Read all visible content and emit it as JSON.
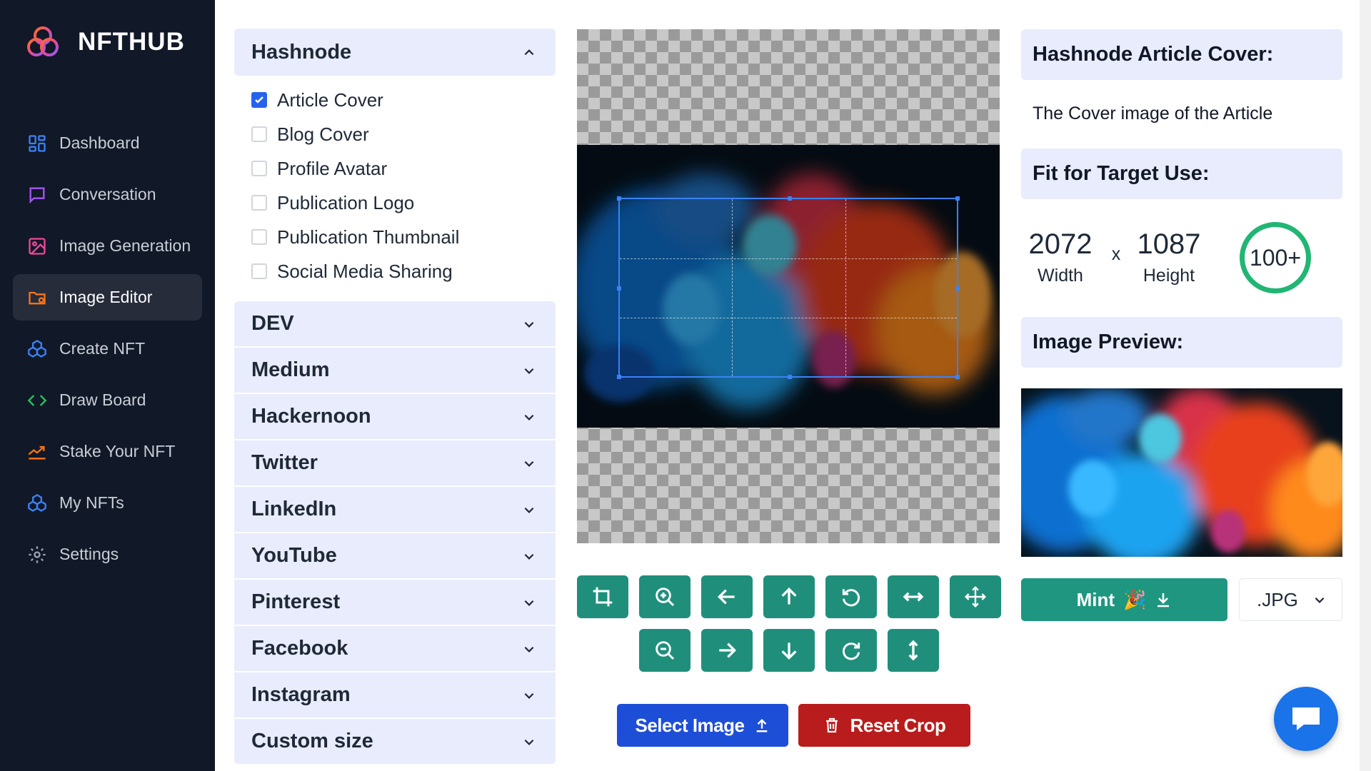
{
  "brand": {
    "name": "NFTHUB"
  },
  "colors": {
    "sidebar_bg": "#111827",
    "accent_teal": "#1f8f7c",
    "select_blue": "#1d4ed8",
    "reset_red": "#b91c1c",
    "score_green": "#22b573"
  },
  "nav": [
    {
      "label": "Dashboard",
      "icon": "dashboard-icon",
      "active": false
    },
    {
      "label": "Conversation",
      "icon": "chat-bubble-icon",
      "active": false
    },
    {
      "label": "Image Generation",
      "icon": "image-icon",
      "active": false
    },
    {
      "label": "Image Editor",
      "icon": "folder-gear-icon",
      "active": true
    },
    {
      "label": "Create NFT",
      "icon": "cubes-icon",
      "active": false
    },
    {
      "label": "Draw Board",
      "icon": "code-icon",
      "active": false
    },
    {
      "label": "Stake Your NFT",
      "icon": "chart-up-icon",
      "active": false
    },
    {
      "label": "My NFTs",
      "icon": "cubes-icon",
      "active": false
    },
    {
      "label": "Settings",
      "icon": "gear-icon",
      "active": false
    }
  ],
  "platforms": {
    "open": {
      "label": "Hashnode",
      "options": [
        {
          "label": "Article Cover",
          "checked": true
        },
        {
          "label": "Blog Cover",
          "checked": false
        },
        {
          "label": "Profile Avatar",
          "checked": false
        },
        {
          "label": "Publication Logo",
          "checked": false
        },
        {
          "label": "Publication Thumbnail",
          "checked": false
        },
        {
          "label": "Social Media Sharing",
          "checked": false
        }
      ]
    },
    "collapsed": [
      "DEV",
      "Medium",
      "Hackernoon",
      "Twitter",
      "LinkedIn",
      "YouTube",
      "Pinterest",
      "Facebook",
      "Instagram",
      "Custom size"
    ]
  },
  "tools": {
    "row1": [
      "crop-icon",
      "zoom-in-icon",
      "arrow-left-icon",
      "arrow-up-icon",
      "rotate-left-icon",
      "flip-horizontal-icon",
      "move-icon"
    ],
    "row2": [
      "zoom-out-icon",
      "arrow-right-icon",
      "arrow-down-icon",
      "rotate-right-icon",
      "flip-vertical-icon"
    ]
  },
  "buttons": {
    "select_image": "Select Image",
    "reset_crop": "Reset Crop",
    "mint": "Mint",
    "mint_emoji": "🎉"
  },
  "info": {
    "cover_title": "Hashnode Article Cover:",
    "cover_desc": "The Cover image of the Article",
    "fit_title": "Fit for Target Use:",
    "width_value": "2072",
    "width_label": "Width",
    "times": "x",
    "height_value": "1087",
    "height_label": "Height",
    "score": "100+",
    "preview_title": "Image Preview:"
  },
  "format": {
    "selected": ".JPG"
  }
}
